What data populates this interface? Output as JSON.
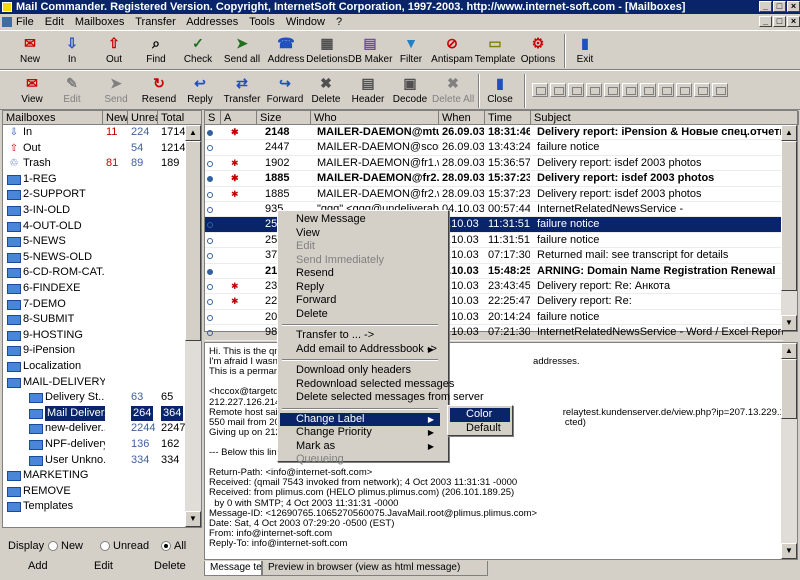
{
  "window": {
    "title": "Mail Commander. Registered Version. Copyright, InternetSoft Corporation, 1997-2003. http://www.internet-soft.com - [Mailboxes]"
  },
  "menubar": [
    "File",
    "Edit",
    "Mailboxes",
    "Transfer",
    "Addresses",
    "Tools",
    "Window",
    "?"
  ],
  "toolbar1": [
    "New",
    "In",
    "Out",
    "Find",
    "Check",
    "Send all",
    "Address",
    "Deletions",
    "DB Maker",
    "Filter",
    "Antispam",
    "Template",
    "Options",
    "Exit"
  ],
  "toolbar2": [
    "View",
    "Edit",
    "Send",
    "Resend",
    "Reply",
    "Transfer",
    "Forward",
    "Delete",
    "Header",
    "Decode",
    "Delete All",
    "Close"
  ],
  "folders": {
    "headers": [
      "Mailboxes",
      "New",
      "Unread",
      "Total"
    ],
    "items": [
      {
        "name": "In",
        "new": "11",
        "unread": "224",
        "total": "1714"
      },
      {
        "name": "Out",
        "new": "",
        "unread": "54",
        "total": "1214"
      },
      {
        "name": "Trash",
        "new": "81",
        "unread": "89",
        "total": "189"
      },
      {
        "name": "1-REG"
      },
      {
        "name": "2-SUPPORT"
      },
      {
        "name": "3-IN-OLD"
      },
      {
        "name": "4-OUT-OLD"
      },
      {
        "name": "5-NEWS"
      },
      {
        "name": "5-NEWS-OLD"
      },
      {
        "name": "6-CD-ROM-CAT..."
      },
      {
        "name": "6-FINDEXE"
      },
      {
        "name": "7-DEMO"
      },
      {
        "name": "8-SUBMIT"
      },
      {
        "name": "9-HOSTING"
      },
      {
        "name": "9-iPension"
      },
      {
        "name": "Localization"
      },
      {
        "name": "MAIL-DELIVERY"
      },
      {
        "name": "Delivery St...",
        "unread": "63",
        "total": "65"
      },
      {
        "name": "Mail Deliver...",
        "unread": "264",
        "total": "364"
      },
      {
        "name": "new-deliver...",
        "unread": "2244",
        "total": "2247"
      },
      {
        "name": "NPF-delivery",
        "unread": "136",
        "total": "162"
      },
      {
        "name": "User Unkno...",
        "unread": "334",
        "total": "334"
      },
      {
        "name": "MARKETING"
      },
      {
        "name": "REMOVE"
      },
      {
        "name": "Templates"
      }
    ]
  },
  "display": {
    "label": "Display",
    "opt_new": "New",
    "opt_unread": "Unread",
    "opt_all": "All"
  },
  "folder_actions": [
    "Add",
    "Edit",
    "Delete"
  ],
  "messages": {
    "headers": [
      "S",
      "A",
      "Size",
      "Who",
      "When",
      "Time",
      "Subject"
    ],
    "rows": [
      {
        "size": "2148",
        "who": "MAILER-DAEMON@mtu-net",
        "when": "26.09.03",
        "time": "18:31:46",
        "subject": "Delivery report: iPension & Новые спец.отчеты"
      },
      {
        "size": "2447",
        "who": "MAILER-DAEMON@scorpions.ne",
        "when": "26.09.03",
        "time": "13:43:24",
        "subject": "failure notice"
      },
      {
        "size": "1902",
        "who": "MAILER-DAEMON@fr1.webmaill",
        "when": "28.09.03",
        "time": "15:36:57",
        "subject": "Delivery report: isdef 2003 photos"
      },
      {
        "size": "1885",
        "who": "MAILER-DAEMON@fr2.webmail",
        "when": "28.09.03",
        "time": "15:37:23",
        "subject": "Delivery report: isdef 2003 photos"
      },
      {
        "size": "1885",
        "who": "MAILER-DAEMON@fr2.webmaill",
        "when": "28.09.03",
        "time": "15:37:23",
        "subject": "Delivery report: isdef 2003 photos"
      },
      {
        "size": "935",
        "who": "\"ggg\" <ggg@undeliverable.zen",
        "when": "04.10.03",
        "time": "00:57:44",
        "subject": "InternetRelatedNewsService -"
      },
      {
        "size": "25",
        "who": "",
        "when": "4.10.03",
        "time": "11:31:51",
        "subject": "failure notice"
      },
      {
        "size": "25",
        "who": "",
        "when": "4.10.03",
        "time": "11:31:51",
        "subject": "failure notice"
      },
      {
        "size": "37",
        "who": "",
        "when": "5.10.03",
        "time": "07:17:30",
        "subject": "Returned mail: see transcript for details"
      },
      {
        "size": "21",
        "who": "",
        "when": "5.10.03",
        "time": "15:48:25",
        "subject": "ARNING: Domain Name Registration Renewal"
      },
      {
        "size": "23",
        "who": "",
        "when": "5.10.03",
        "time": "23:43:45",
        "subject": "Delivery report: Re: Анкота"
      },
      {
        "size": "22",
        "who": "",
        "when": "7.10.03",
        "time": "22:25:47",
        "subject": "Delivery report: Re:"
      },
      {
        "size": "20",
        "who": "",
        "when": "9.10.03",
        "time": "20:14:24",
        "subject": "failure notice"
      },
      {
        "size": "98",
        "who": "",
        "when": "0.10.03",
        "time": "07:21:30",
        "subject": "InternetRelatedNewsService - Word / Excel Report Builder"
      }
    ]
  },
  "preview": {
    "lines": [
      "Hi. This is the qma",
      "I'm afraid I wasn't                                                                                               addresses.",
      "This is a permanen",
      "",
      "<hccox@targetda",
      "212.227.126.214",
      "Remote host said                                                                                                          relaytest.kundenserver.de/view.php?ip=207.13.229.111",
      "550 mail from 207                                                                                                          cted)",
      "Giving up on 212.",
      "",
      "--- Below this line",
      "",
      "Return-Path: <info@internet-soft.com>",
      "Received: (qmail 7543 invoked from network); 4 Oct 2003 11:31:31 -0000",
      "Received: from plimus.com (HELO plimus.plimus.com) (206.101.189.25)",
      "  by 0 with SMTP; 4 Oct 2003 11:31:31 -0000",
      "Message-ID: <12690765.1065270560075.JavaMail.root@plimus.plimus.com>",
      "Date: Sat, 4 Oct 2003 07:29:20 -0500 (EST)",
      "From: info@internet-soft.com",
      "Reply-To: info@internet-soft.com"
    ]
  },
  "tabs": [
    "Message text",
    "Preview in browser (view as html message)"
  ],
  "context_menu": {
    "items": [
      "New Message",
      "View",
      "Edit",
      "Send Immediately",
      "Resend",
      "Reply",
      "Forward",
      "Delete",
      "Transfer to ... ->",
      "Add email to Addressbook ->",
      "Download only headers",
      "Redownload selected messages",
      "Delete selected messages from server",
      "Change Label",
      "Change Priority",
      "Mark as",
      "Queueing"
    ]
  },
  "submenu": [
    "Color",
    "Default"
  ]
}
